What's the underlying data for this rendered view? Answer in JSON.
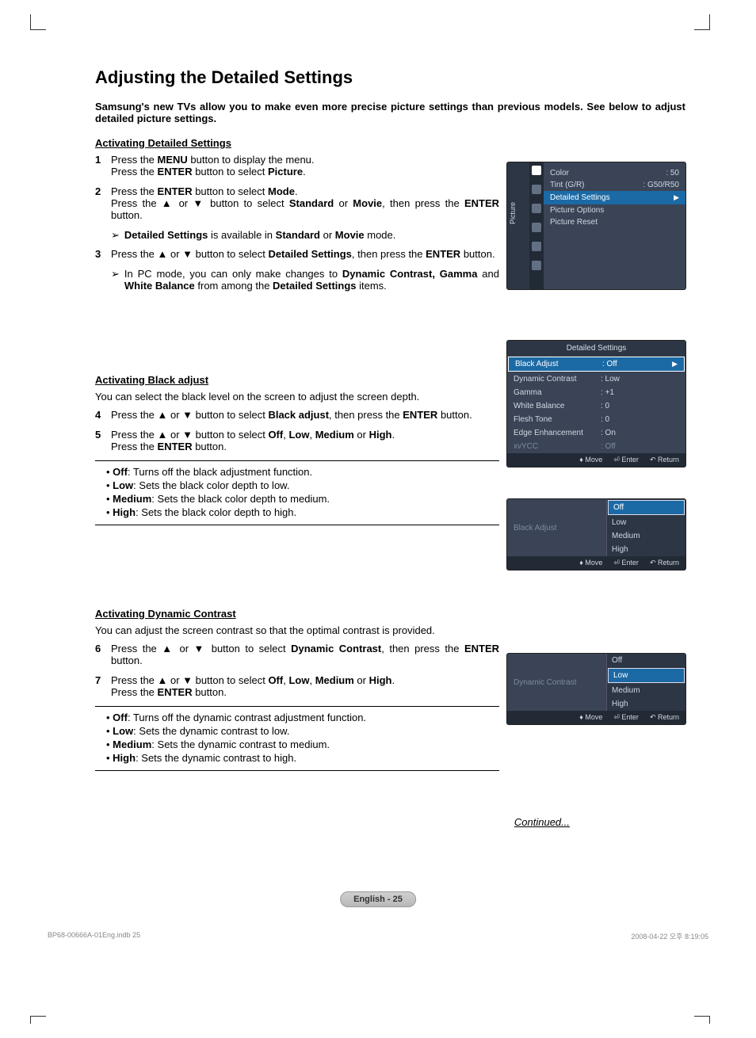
{
  "title": "Adjusting the Detailed Settings",
  "intro": "Samsung's new TVs allow you to make even more precise picture settings than previous models. See below to adjust detailed picture settings.",
  "sec1": {
    "heading": "Activating Detailed Settings",
    "step1a": "Press the ",
    "step1b": " button to display the menu.",
    "step1c": "Press the ",
    "step1d": " button to select ",
    "step1e": ".",
    "menu": "MENU",
    "enter": "ENTER",
    "picture": "Picture",
    "step2a": "Press the ",
    "step2b": " button to select ",
    "step2c": ".",
    "mode": "Mode",
    "step2d": "Press the ▲ or ▼ button to select ",
    "standard": "Standard",
    "or": " or ",
    "movie": "Movie",
    "step2e": ", then press the ",
    "step2f": " button.",
    "note1a": "Detailed Settings",
    "note1b": " is available in ",
    "note1c": " mode.",
    "step3a": "Press the ▲ or ▼ button to select ",
    "detset": "Detailed Settings",
    "step3b": ", then press the ",
    "step3c": " button.",
    "note2a": "In PC mode, you can only make changes to ",
    "dyncon": "Dynamic Contrast, Gamma",
    "note2b": " and ",
    "wb": "White Balance",
    "note2c": " from among the ",
    "note2d": " items."
  },
  "sec2": {
    "heading": "Activating Black adjust",
    "desc": "You can select the black level on the screen to adjust the screen depth.",
    "step4a": "Press the ▲ or ▼ button to select ",
    "blackadj": "Black adjust",
    "step4b": ", then press the ",
    "step4c": " button.",
    "step5a": "Press the ▲ or ▼ button to select ",
    "off": "Off",
    "low": "Low",
    "med": "Medium",
    "high": "High",
    "step5b": ".",
    "step5c": "Press the ",
    "step5d": " button.",
    "b_off": ": Turns off the black adjustment function.",
    "b_low": ": Sets the black color depth to low.",
    "b_med": ": Sets the black color depth to medium.",
    "b_high": ": Sets the black color depth to high."
  },
  "sec3": {
    "heading": "Activating Dynamic Contrast",
    "desc": "You can adjust the screen contrast so that the optimal contrast is provided.",
    "step6a": "Press the ▲ or ▼ button to select ",
    "dc": "Dynamic Contrast",
    "step6b": ", then press the ",
    "step6c": " button.",
    "step7a": "Press the ▲ or ▼ button to select ",
    "step7b": ".",
    "step7c": "Press the ",
    "step7d": " button.",
    "b_off": ": Turns off the dynamic contrast adjustment function.",
    "b_low": ": Sets the dynamic contrast to low.",
    "b_med": ": Sets the dynamic contrast to medium.",
    "b_high": ": Sets the dynamic contrast to high."
  },
  "osd1": {
    "sidelabel": "Picture",
    "color": "Color",
    "color_v": ": 50",
    "tint": "Tint (G/R)",
    "tint_v": ": G50/R50",
    "hl": "Detailed Settings",
    "po": "Picture Options",
    "pr": "Picture Reset"
  },
  "osd2": {
    "title": "Detailed Settings",
    "rows": [
      {
        "k": "Black Adjust",
        "v": ": Off",
        "hl": true
      },
      {
        "k": "Dynamic Contrast",
        "v": ": Low"
      },
      {
        "k": "Gamma",
        "v": ": +1"
      },
      {
        "k": "White Balance",
        "v": ": 0"
      },
      {
        "k": "Flesh Tone",
        "v": ": 0"
      },
      {
        "k": "Edge Enhancement",
        "v": ": On"
      },
      {
        "k": "xvYCC",
        "v": ": Off",
        "dim": true
      }
    ],
    "move": "Move",
    "enter": "Enter",
    "return": "Return"
  },
  "osd3": {
    "label": "Black Adjust",
    "opts": [
      "Off",
      "Low",
      "Medium",
      "High"
    ],
    "sel": "Off",
    "move": "Move",
    "enter": "Enter",
    "return": "Return"
  },
  "osd4": {
    "label": "Dynamic Contrast",
    "opts": [
      "Off",
      "Low",
      "Medium",
      "High"
    ],
    "sel": "Low",
    "move": "Move",
    "enter": "Enter",
    "return": "Return"
  },
  "continued": "Continued...",
  "pagepill": "English - 25",
  "footer_left": "BP68-00666A-01Eng.indb   25",
  "footer_right": "2008-04-22   오후 8:19:05"
}
